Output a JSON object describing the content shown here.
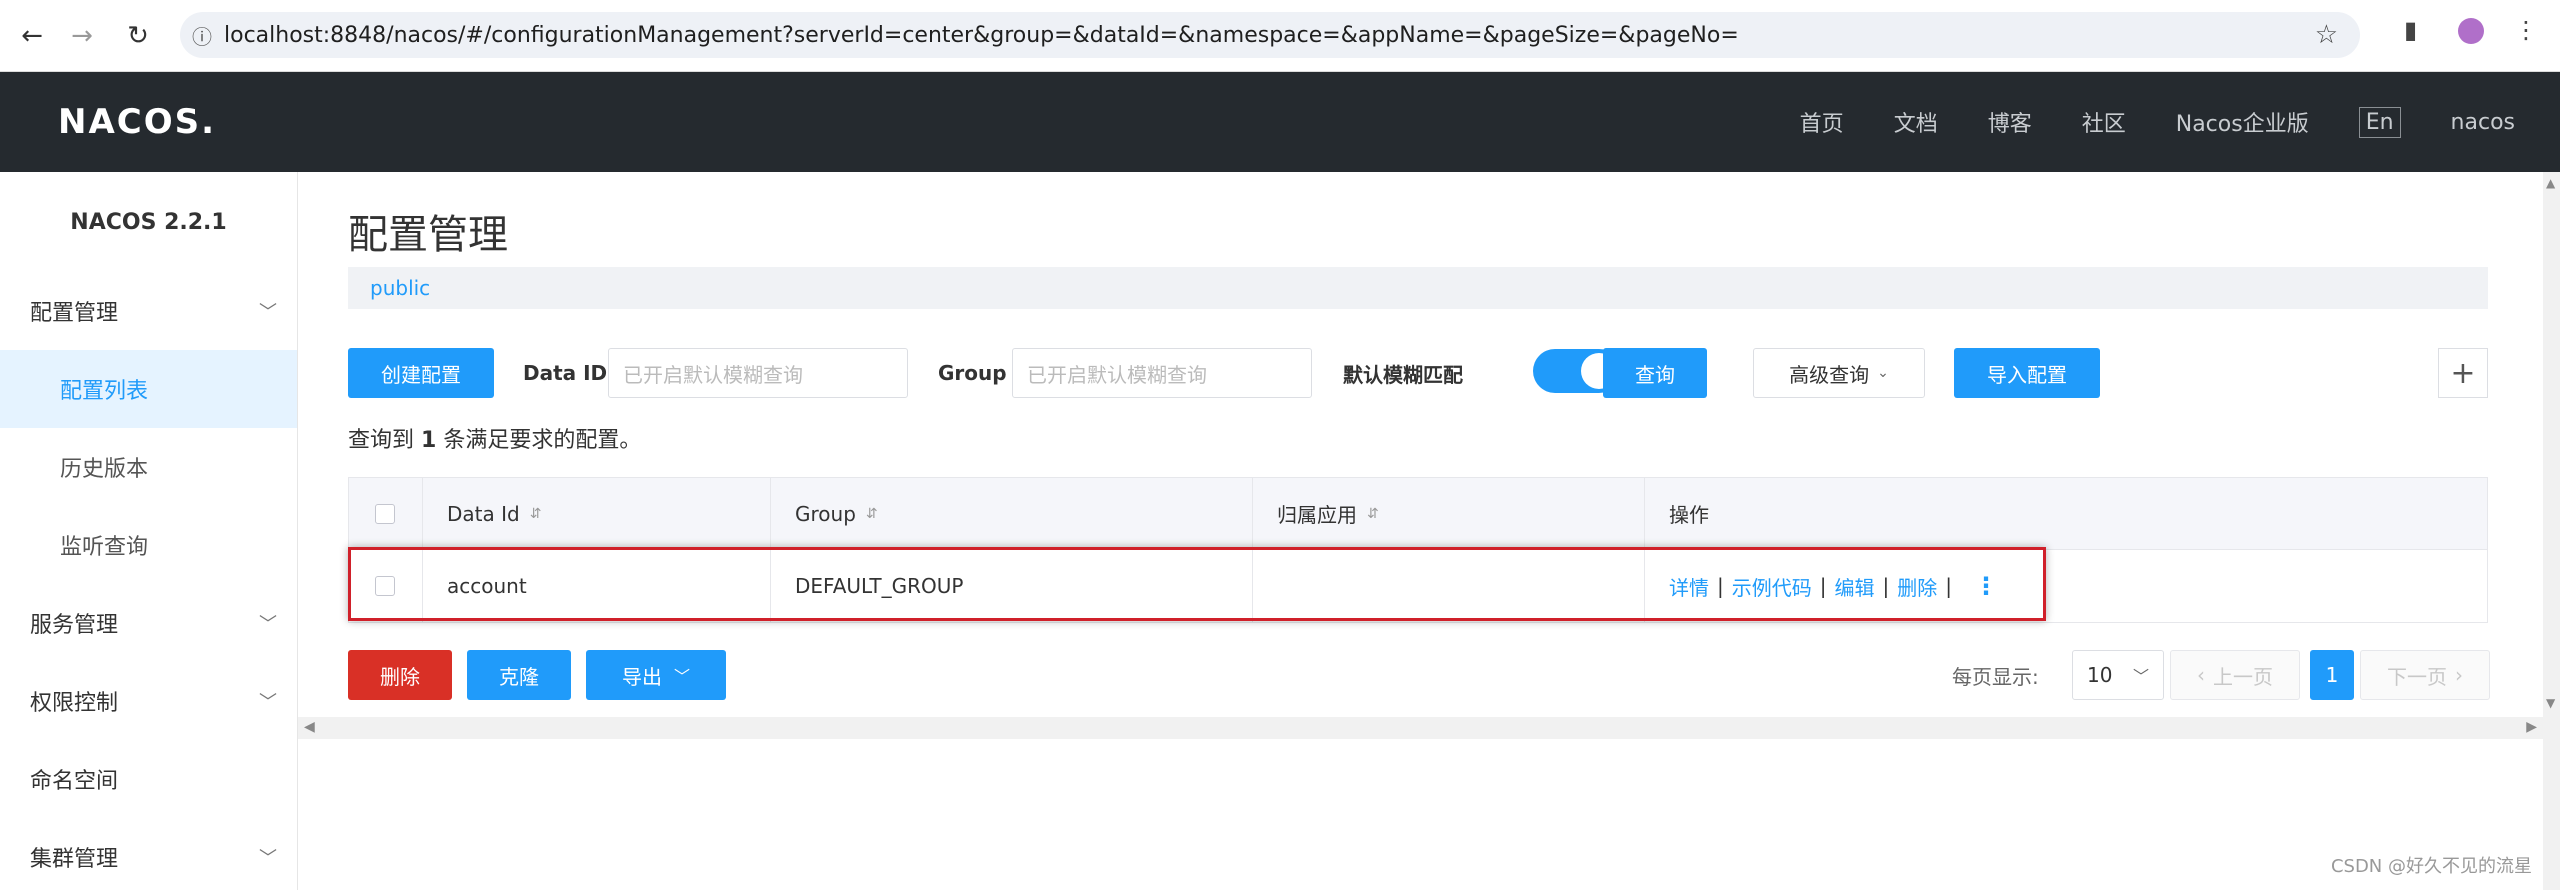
{
  "browser": {
    "url": "localhost:8848/nacos/#/configurationManagement?serverId=center&group=&dataId=&namespace=&appName=&pageSize=&pageNo="
  },
  "header": {
    "logo": "NACOS.",
    "menu": [
      "首页",
      "文档",
      "博客",
      "社区",
      "Nacos企业版"
    ],
    "lang": "En",
    "user": "nacos"
  },
  "sidebar": {
    "version": "NACOS 2.2.1",
    "items": [
      {
        "label": "配置管理"
      },
      {
        "label": "配置列表"
      },
      {
        "label": "历史版本"
      },
      {
        "label": "监听查询"
      },
      {
        "label": "服务管理"
      },
      {
        "label": "权限控制"
      },
      {
        "label": "命名空间"
      },
      {
        "label": "集群管理"
      }
    ]
  },
  "main": {
    "title": "配置管理",
    "namespace": "public",
    "toolbar": {
      "create_label": "创建配置",
      "dataid_label": "Data ID",
      "dataid_placeholder": "已开启默认模糊查询",
      "group_label": "Group",
      "group_placeholder": "已开启默认模糊查询",
      "fuzzy_label": "默认模糊匹配",
      "query_label": "查询",
      "advanced_label": "高级查询",
      "import_label": "导入配置"
    },
    "result": {
      "prefix": "查询到",
      "count": "1",
      "suffix": "条满足要求的配置。"
    },
    "table": {
      "headers": [
        "Data Id",
        "Group",
        "归属应用",
        "操作"
      ],
      "rows": [
        {
          "data_id": "account",
          "group": "DEFAULT_GROUP",
          "app": "",
          "ops": [
            "详情",
            "示例代码",
            "编辑",
            "删除"
          ]
        }
      ]
    },
    "bottom": {
      "delete_label": "删除",
      "clone_label": "克隆",
      "export_label": "导出",
      "page_size_label": "每页显示:",
      "page_size": "10",
      "prev_label": "上一页",
      "current_page": "1",
      "next_label": "下一页"
    }
  },
  "watermark": "CSDN @好久不见的流星"
}
